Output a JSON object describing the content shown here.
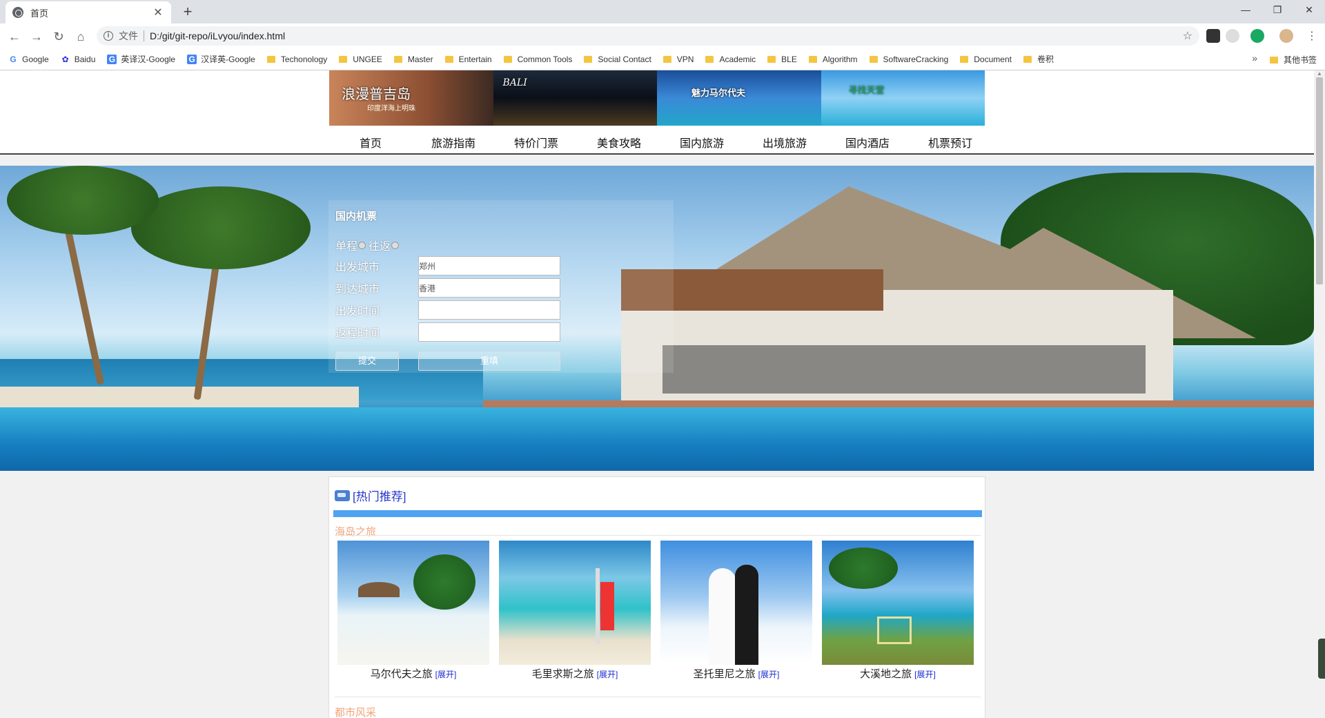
{
  "browser": {
    "tab_title": "首页",
    "new_tab": "+",
    "address_prefix": "文件",
    "url": "D:/git/git-repo/iLvyou/index.html",
    "window_controls": [
      "—",
      "❐",
      "✕"
    ]
  },
  "bookmarks": {
    "items": [
      "Google",
      "Baidu",
      "英译汉-Google",
      "汉译英-Google",
      "Techonology",
      "UNGEE",
      "Master",
      "Entertain",
      "Common Tools",
      "Social Contact",
      "VPN",
      "Academic",
      "BLE",
      "Algorithm",
      "SoftwareCracking",
      "Document",
      "卷积"
    ],
    "more": "»",
    "other": "其他书签"
  },
  "banner": {
    "captions": [
      "浪漫普吉岛",
      "BALI",
      "魅力马尔代夫",
      "寻找天堂"
    ],
    "subcaption": "印度洋海上明珠"
  },
  "nav": [
    "首页",
    "旅游指南",
    "特价门票",
    "美食攻略",
    "国内旅游",
    "出境旅游",
    "国内酒店",
    "机票预订"
  ],
  "flight_form": {
    "title": "国内机票",
    "one_way": "单程",
    "round_trip": "往返",
    "depart_city_label": "出发城市",
    "depart_city_value": "郑州",
    "arrive_city_label": "到达城市",
    "arrive_city_value": "香港",
    "depart_time_label": "出发时间",
    "return_time_label": "返程时间",
    "submit": "提交",
    "reset": "重填"
  },
  "hot": {
    "title": "[热门推荐]",
    "section1": "海岛之旅",
    "section2": "都市风采",
    "more_label": "[展开]",
    "cards": [
      {
        "name": "马尔代夫之旅"
      },
      {
        "name": "毛里求斯之旅"
      },
      {
        "name": "圣托里尼之旅"
      },
      {
        "name": "大溪地之旅"
      }
    ]
  },
  "colors": {
    "nav_underline": "#444444",
    "hot_bar": "#4fa3f0",
    "hot_title": "#2838c8",
    "section_title": "#f0a47a",
    "more_link": "#1a2bd1"
  }
}
